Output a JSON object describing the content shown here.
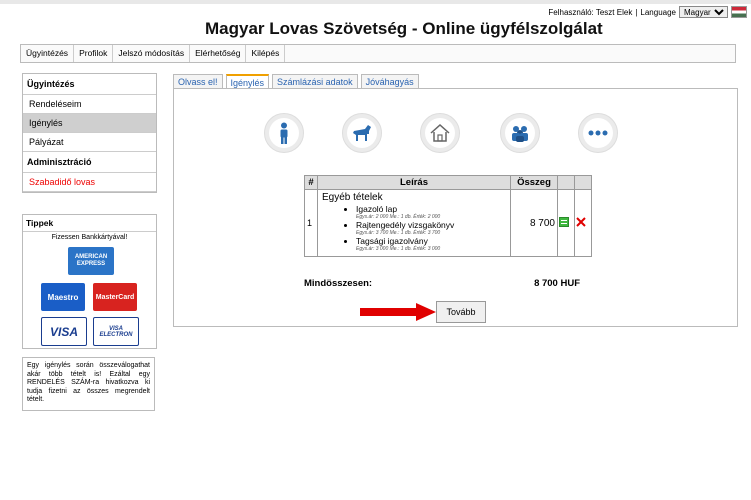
{
  "header": {
    "user_label": "Felhasználó: Teszt Elek",
    "language_label": "Language",
    "language_value": "Magyar",
    "title": "Magyar Lovas Szövetség - Online ügyfélszolgálat"
  },
  "topnav": [
    "Ügyintézés",
    "Profilok",
    "Jelszó módosítás",
    "Elérhetőség",
    "Kilépés"
  ],
  "sidebar": {
    "heading1": "Ügyintézés",
    "items": [
      "Rendeléseim",
      "Igénylés",
      "Pályázat"
    ],
    "heading2": "Adminisztráció",
    "admin_item": "Szabadidő lovas"
  },
  "tips": {
    "heading": "Tippek",
    "subtitle": "Fizessen Bankkártyával!",
    "cards": [
      "AMERICAN EXPRESS",
      "Maestro",
      "MasterCard",
      "VISA",
      "VISA ELECTRON"
    ],
    "text": "Egy igénylés során összeválogathat akár több tételt is! Ezáltal egy RENDELÉS SZÁM-ra hivatkozva ki tudja fizetni az összes megrendelt tételt."
  },
  "tabs": [
    "Olvass el!",
    "Igénylés",
    "Számlázási adatok",
    "Jóváhagyás"
  ],
  "category_icons": [
    "person-icon",
    "horse-icon",
    "house-icon",
    "group-icon",
    "more-icon"
  ],
  "table": {
    "headers": [
      "#",
      "Leírás",
      "Összeg"
    ],
    "row_no": "1",
    "group_title": "Egyéb tételek",
    "items": [
      {
        "name": "Igazoló lap",
        "detail": "Egys.ár: 2 000 Me.: 1 db. Érték: 2 000"
      },
      {
        "name": "Rajtengedély vizsgakönyv",
        "detail": "Egys.ár: 3 700 Me.: 1 db. Érték: 3 700"
      },
      {
        "name": "Tagsági igazolvány",
        "detail": "Egys.ár: 3 000 Me.: 1 db. Érték: 3 000"
      }
    ],
    "amount": "8 700",
    "total_label": "Mindösszesen:",
    "total_value": "8 700 HUF"
  },
  "next_button": "Tovább",
  "colors": {
    "accent": "#2a63b0",
    "red": "#e00000",
    "tab_active": "#f0a000"
  }
}
